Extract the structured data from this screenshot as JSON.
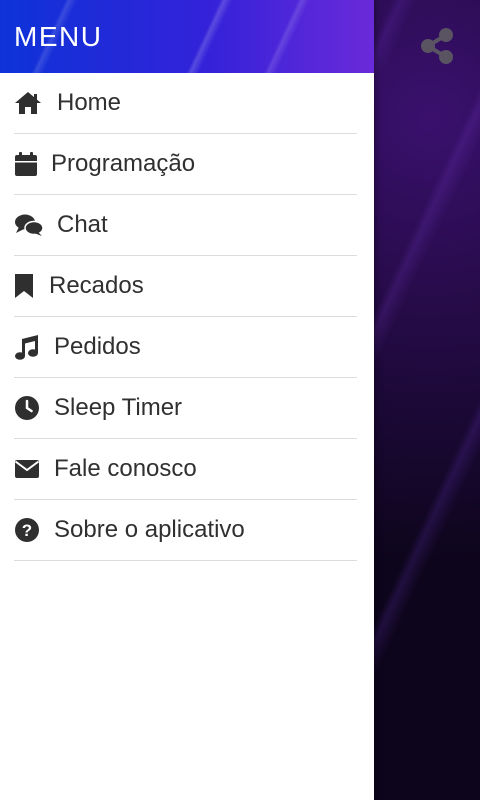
{
  "drawer": {
    "title": "MENU",
    "items": [
      {
        "label": "Home",
        "icon": "home-icon"
      },
      {
        "label": "Programação",
        "icon": "calendar-icon"
      },
      {
        "label": "Chat",
        "icon": "chat-icon"
      },
      {
        "label": "Recados",
        "icon": "bookmark-icon"
      },
      {
        "label": "Pedidos",
        "icon": "music-note-icon"
      },
      {
        "label": "Sleep Timer",
        "icon": "clock-icon"
      },
      {
        "label": "Fale conosco",
        "icon": "envelope-icon"
      },
      {
        "label": "Sobre o aplicativo",
        "icon": "question-circle-icon"
      }
    ]
  },
  "app": {
    "share_icon": "share-icon"
  },
  "colors": {
    "header_gradient_start": "#0d33d8",
    "header_gradient_end": "#6a2ad9",
    "background_dark": "#0b0418",
    "menu_text": "#303030",
    "divider": "#dcdcdc"
  }
}
